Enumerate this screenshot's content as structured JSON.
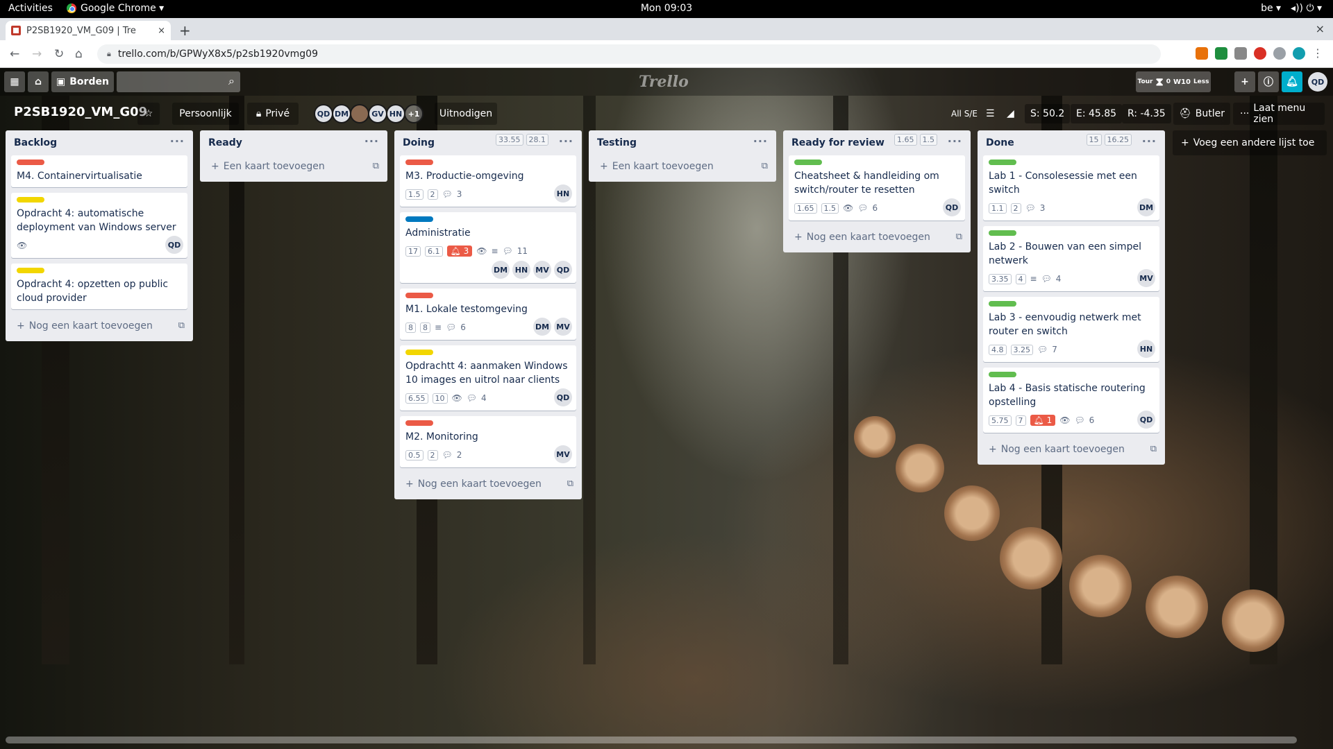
{
  "gnome": {
    "activities": "Activities",
    "app": "Google Chrome ▾",
    "clock": "Mon 09:03",
    "locale": "be ▾",
    "tray": "◂))  ⏻ ▾"
  },
  "browser": {
    "tab_title": "P2SB1920_VM_G09 | Tre",
    "close": "×",
    "new_tab": "+",
    "url": "trello.com/b/GPWyX8x5/p2sb1920vmg09",
    "win_close": "×"
  },
  "header": {
    "boards_label": "Borden",
    "logo": "Trello",
    "user_initials": "QD",
    "tour": "Tour",
    "w10": "W10",
    "less": "Less",
    "count_zero": "0"
  },
  "board": {
    "title": "P2SB1920_VM_G09",
    "team": "Persoonlijk",
    "visibility": "Privé",
    "invite": "Uitnodigen",
    "members": [
      "QD",
      "DM",
      "",
      "GV",
      "HN"
    ],
    "member_more": "+1",
    "stats": {
      "all_label": "All S/E",
      "s": "S: 50.2",
      "e": "E: 45.85",
      "r": "R: -4.35"
    },
    "butler": "Butler",
    "menu": "Laat menu zien",
    "add_list": "Voeg een andere lijst toe"
  },
  "colors": {
    "red": "#eb5a46",
    "yellow": "#f2d600",
    "blue": "#0079bf",
    "green": "#61bd4f"
  },
  "lists": [
    {
      "title": "Backlog",
      "add": "Nog een kaart toevoegen",
      "cards": [
        {
          "label": "red",
          "title": "M4. Containervirtualisatie"
        },
        {
          "label": "yellow",
          "title": "Opdracht 4: automatische deployment van Windows server",
          "watch": true,
          "members": [
            "QD"
          ]
        },
        {
          "label": "yellow",
          "title": "Opdracht 4: opzetten op public cloud provider"
        }
      ]
    },
    {
      "title": "Ready",
      "add": "Een kaart toevoegen",
      "cards": []
    },
    {
      "title": "Doing",
      "badges": [
        "33.55",
        "28.1"
      ],
      "add": "Nog een kaart toevoegen",
      "cards": [
        {
          "label": "red",
          "title": "M3. Productie-omgeving",
          "nums": [
            "1.5",
            "2"
          ],
          "comments": "3",
          "members": [
            "HN"
          ]
        },
        {
          "label": "blue",
          "title": "Administratie",
          "nums": [
            "17",
            "6.1"
          ],
          "due": "3",
          "watch": true,
          "desc": true,
          "comments": "11",
          "members": [
            "DM",
            "HN",
            "MV",
            "QD"
          ]
        },
        {
          "label": "red",
          "title": "M1. Lokale testomgeving",
          "nums": [
            "8",
            "8"
          ],
          "desc": true,
          "comments": "6",
          "members": [
            "DM",
            "MV"
          ]
        },
        {
          "label": "yellow",
          "title": "Opdrachtt 4: aanmaken Windows 10 images en uitrol naar clients",
          "nums": [
            "6.55",
            "10"
          ],
          "watch": true,
          "comments": "4",
          "members": [
            "QD"
          ]
        },
        {
          "label": "red",
          "title": "M2. Monitoring",
          "nums": [
            "0.5",
            "2"
          ],
          "comments": "2",
          "members": [
            "MV"
          ]
        }
      ]
    },
    {
      "title": "Testing",
      "add": "Een kaart toevoegen",
      "cards": []
    },
    {
      "title": "Ready for review",
      "badges": [
        "1.65",
        "1.5"
      ],
      "add": "Nog een kaart toevoegen",
      "cards": [
        {
          "label": "green",
          "title": "Cheatsheet & handleiding om switch/router te resetten",
          "nums": [
            "1.65",
            "1.5"
          ],
          "watch": true,
          "comments": "6",
          "members": [
            "QD"
          ]
        }
      ]
    },
    {
      "title": "Done",
      "badges": [
        "15",
        "16.25"
      ],
      "add": "Nog een kaart toevoegen",
      "cards": [
        {
          "label": "green",
          "title": "Lab 1 - Consolesessie met een switch",
          "nums": [
            "1.1",
            "2"
          ],
          "comments": "3",
          "members": [
            "DM"
          ]
        },
        {
          "label": "green",
          "title": "Lab 2 - Bouwen van een simpel netwerk",
          "nums": [
            "3.35",
            "4"
          ],
          "desc": true,
          "comments": "4",
          "members": [
            "MV"
          ]
        },
        {
          "label": "green",
          "title": "Lab 3 - eenvoudig netwerk met router en switch",
          "nums": [
            "4.8",
            "3.25"
          ],
          "comments": "7",
          "members": [
            "HN"
          ]
        },
        {
          "label": "green",
          "title": "Lab 4 - Basis statische routering opstelling",
          "nums": [
            "5.75",
            "7"
          ],
          "due": "1",
          "watch": true,
          "comments": "6",
          "members": [
            "QD"
          ]
        }
      ]
    }
  ]
}
